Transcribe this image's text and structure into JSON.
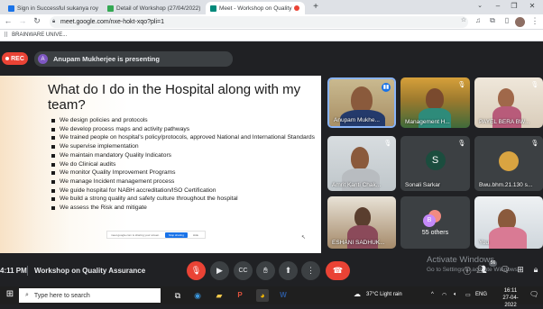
{
  "browser": {
    "tabs": [
      {
        "label": "Sign in Successful sukanya roy",
        "favicon_color": "#1a73e8"
      },
      {
        "label": "Detail of Workshop (27/04/2022)",
        "favicon_color": "#34a853"
      },
      {
        "label": "Meet - Workshop on Quality",
        "favicon_color": "#00897b",
        "active": true
      }
    ],
    "url": "meet.google.com/nxe-hokt-xqo?pli=1",
    "bookmark": "BRAINWARE UNIVE..."
  },
  "meet": {
    "rec_label": "REC",
    "presenter_avatar": "A",
    "presenter_text": "Anupam Mukherjee is presenting",
    "slide": {
      "title": "What do I do in the Hospital along with my team?",
      "bullets": [
        "We design policies  and protocols",
        "We develop process maps and activity pathways",
        "We trained people on hospital's policy/protocols, approved National and International Standards",
        "We supervise implementation",
        "We maintain mandatory Quality Indicators",
        "We do Clinical audits",
        "We monitor Quality Improvement Programs",
        "We manage Incident  management process",
        "We guide hospital for NABH accreditation/ISO Certification",
        "We build a strong quality and safety culture throughout the hospital",
        "We assess the Risk and mitigate"
      ],
      "share_text": "meet.google.com is sharing your screen.",
      "stop_label": "Stop sharing",
      "hide_label": "Hide"
    },
    "participants": [
      {
        "name": "Anupam Mukhe...",
        "speaking": true
      },
      {
        "name": "Management H..."
      },
      {
        "name": "PAYEL BERA BW..."
      },
      {
        "name": "Amrit Kanti Chak..."
      },
      {
        "name": "Sonali Sarkar",
        "avatar": "S"
      },
      {
        "name": "Bwu.bhm.21.130 s..."
      },
      {
        "name": "ESHANI SADHUK..."
      },
      {
        "name": "55 others"
      },
      {
        "name": "You"
      }
    ],
    "time": "4:11 PM",
    "meeting_name": "Workshop on Quality Assurance",
    "participant_count": "56",
    "activate_title": "Activate Windows",
    "activate_sub": "Go to Settings to activate Windows."
  },
  "taskbar": {
    "search_placeholder": "Type here to search",
    "weather": "37°C  Light rain",
    "lang": "ENG",
    "time": "16:11",
    "date": "27-04-2022"
  },
  "colors": {
    "rec": "#ea4335",
    "meet_bg": "#202124",
    "tile_bg": "#3c4043",
    "accent": "#1a73e8"
  }
}
